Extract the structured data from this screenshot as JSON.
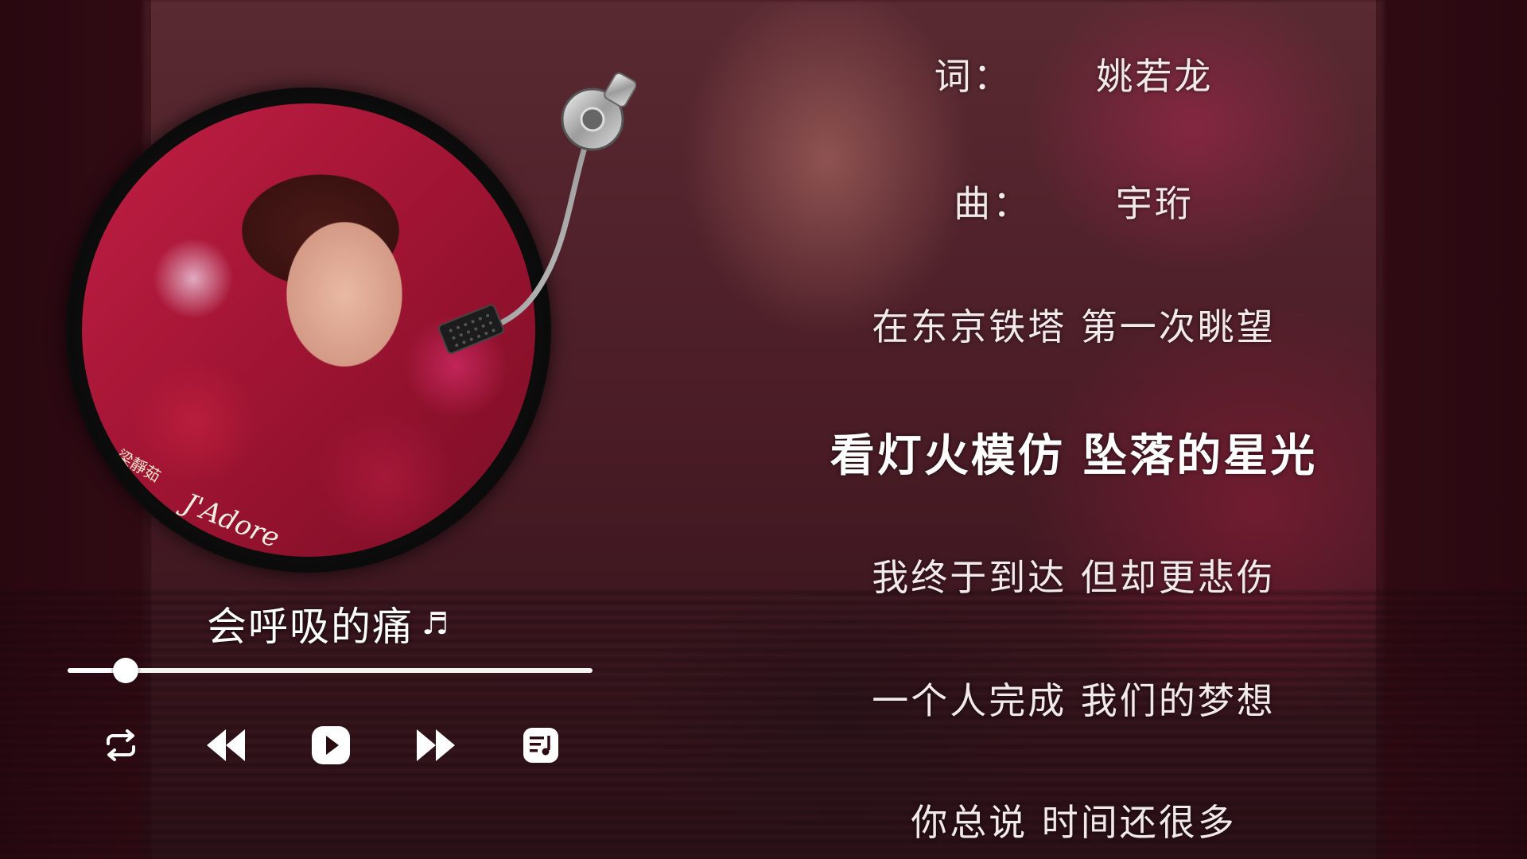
{
  "player": {
    "song_title": "会呼吸的痛",
    "note_icon": "♬",
    "progress": 0.11,
    "cover": {
      "title_glyph": "",
      "artist": "梁靜茹",
      "album": "J'Adore"
    }
  },
  "controls": [
    {
      "name": "repeat-icon"
    },
    {
      "name": "previous-icon"
    },
    {
      "name": "play-icon"
    },
    {
      "name": "next-icon"
    },
    {
      "name": "playlist-icon"
    }
  ],
  "lyrics": {
    "active_index": 3,
    "lines": [
      "词：      姚若龙",
      "曲：      宇珩",
      "在东京铁塔 第一次眺望",
      "看灯火模仿 坠落的星光",
      "我终于到达 但却更悲伤",
      "一个人完成 我们的梦想",
      "你总说 时间还很多"
    ]
  },
  "colors": {
    "background": "#3a0d17",
    "text": "#ffffff"
  }
}
